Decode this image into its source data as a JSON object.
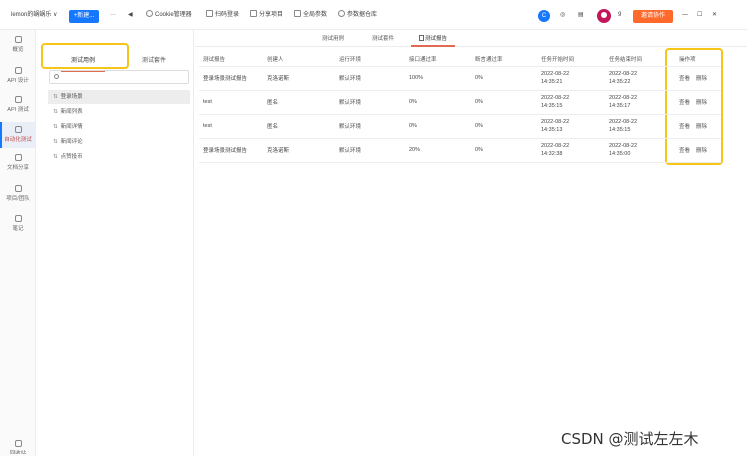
{
  "topbar": {
    "project": "lemon的蜗蜗乐 ∨",
    "new_button": "+新建...",
    "more": "···",
    "back_icon": "◀",
    "cookie": "Cookie管理器",
    "scan": "扫码登录",
    "share": "分享项目",
    "global_params": "全局参数",
    "param_db": "参数据仓库",
    "circle_label": "C",
    "badge": "9",
    "invite": "邀请协作",
    "window_controls": [
      "—",
      "☐",
      "✕"
    ]
  },
  "rail": [
    {
      "label": "概览",
      "icon": "gauge-icon"
    },
    {
      "label": "API 设计",
      "icon": "api-design-icon"
    },
    {
      "label": "API 测试",
      "icon": "api-test-icon"
    },
    {
      "label": "自动化测试",
      "icon": "automation-icon",
      "active": true
    },
    {
      "label": "文档分享",
      "icon": "share-doc-icon"
    },
    {
      "label": "项目/团队",
      "icon": "team-icon"
    },
    {
      "label": "笔记",
      "icon": "note-icon"
    },
    {
      "label": "回收站",
      "icon": "trash-icon"
    }
  ],
  "panel": {
    "tabs": [
      "测试用例",
      "测试套件"
    ],
    "cases": [
      "登录场景",
      "新闻列表",
      "新闻详情",
      "新闻评论",
      "点赞投币"
    ],
    "case_symbol": "⇅"
  },
  "main": {
    "tabs": [
      "测试用例",
      "测试套件",
      "测试报告"
    ],
    "columns": [
      "测试报告",
      "创建人",
      "运行环境",
      "接口通过率",
      "断言通过率",
      "任务开始时间",
      "任务结束时间",
      "操作项"
    ],
    "rows": [
      {
        "report": "登录场景测试报告",
        "creator": "克洛诺斯",
        "env": "默认环境",
        "api_rate": "100%",
        "assert_rate": "0%",
        "start": [
          "2022-08-22",
          "14:35:21"
        ],
        "end": [
          "2022-08-22",
          "14:35:22"
        ]
      },
      {
        "report": "test",
        "creator": "匿名",
        "env": "默认环境",
        "api_rate": "0%",
        "assert_rate": "0%",
        "start": [
          "2022-08-22",
          "14:35:15"
        ],
        "end": [
          "2022-08-22",
          "14:35:17"
        ]
      },
      {
        "report": "test",
        "creator": "匿名",
        "env": "默认环境",
        "api_rate": "0%",
        "assert_rate": "0%",
        "start": [
          "2022-08-22",
          "14:35:13"
        ],
        "end": [
          "2022-08-22",
          "14:35:15"
        ]
      },
      {
        "report": "登录场景测试报告",
        "creator": "克洛诺斯",
        "env": "默认环境",
        "api_rate": "20%",
        "assert_rate": "0%",
        "start": [
          "2022-08-22",
          "14:32:38"
        ],
        "end": [
          "2022-08-22",
          "14:35:00"
        ]
      }
    ],
    "op_view": "查看",
    "op_delete": "删除"
  },
  "watermark": "CSDN @测试左左木",
  "colors": {
    "accent": "#1677ff",
    "invite": "#ff6a2c",
    "highlight": "#f5c518",
    "tab_underline": "#e06b50"
  }
}
